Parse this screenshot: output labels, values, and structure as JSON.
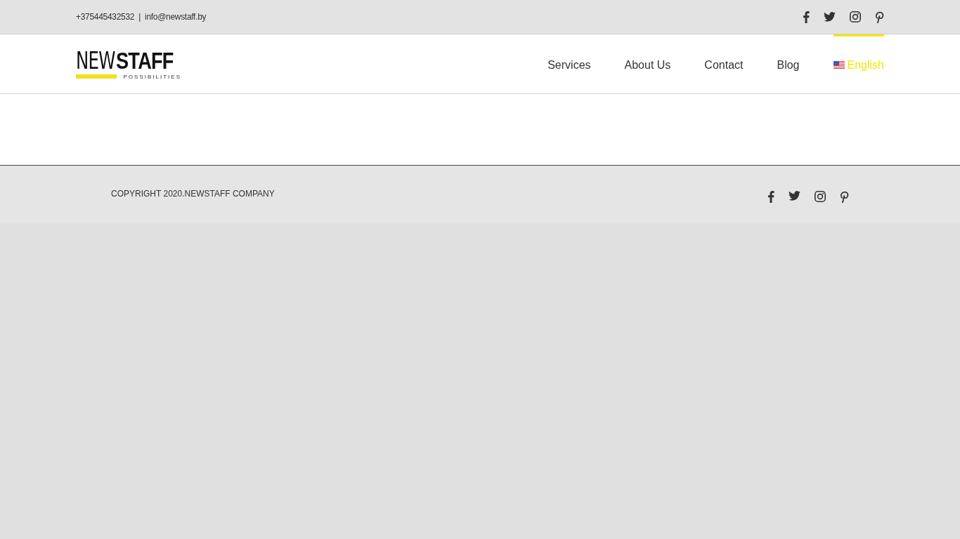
{
  "top_bar": {
    "phone": "+375445432532",
    "separator": "|",
    "email": "info@newstaff.by",
    "social": [
      {
        "kind": "facebook"
      },
      {
        "kind": "twitter"
      },
      {
        "kind": "instagram"
      },
      {
        "kind": "pinterest"
      }
    ]
  },
  "logo": {
    "first": "NEW",
    "second": "STAFF",
    "tagline": "POSSIBILITIES"
  },
  "nav": [
    {
      "label": "Services",
      "selected": false
    },
    {
      "label": "About Us",
      "selected": false
    },
    {
      "label": "Contact",
      "selected": false
    },
    {
      "label": "Blog",
      "selected": false
    },
    {
      "label": "English",
      "selected": true,
      "kind": "language"
    }
  ],
  "footer": {
    "copyright": "COPYRIGHT 2020.NEWSTAFF COMPANY",
    "social": [
      {
        "kind": "facebook"
      },
      {
        "kind": "twitter"
      },
      {
        "kind": "instagram"
      },
      {
        "kind": "pinterest"
      }
    ]
  }
}
